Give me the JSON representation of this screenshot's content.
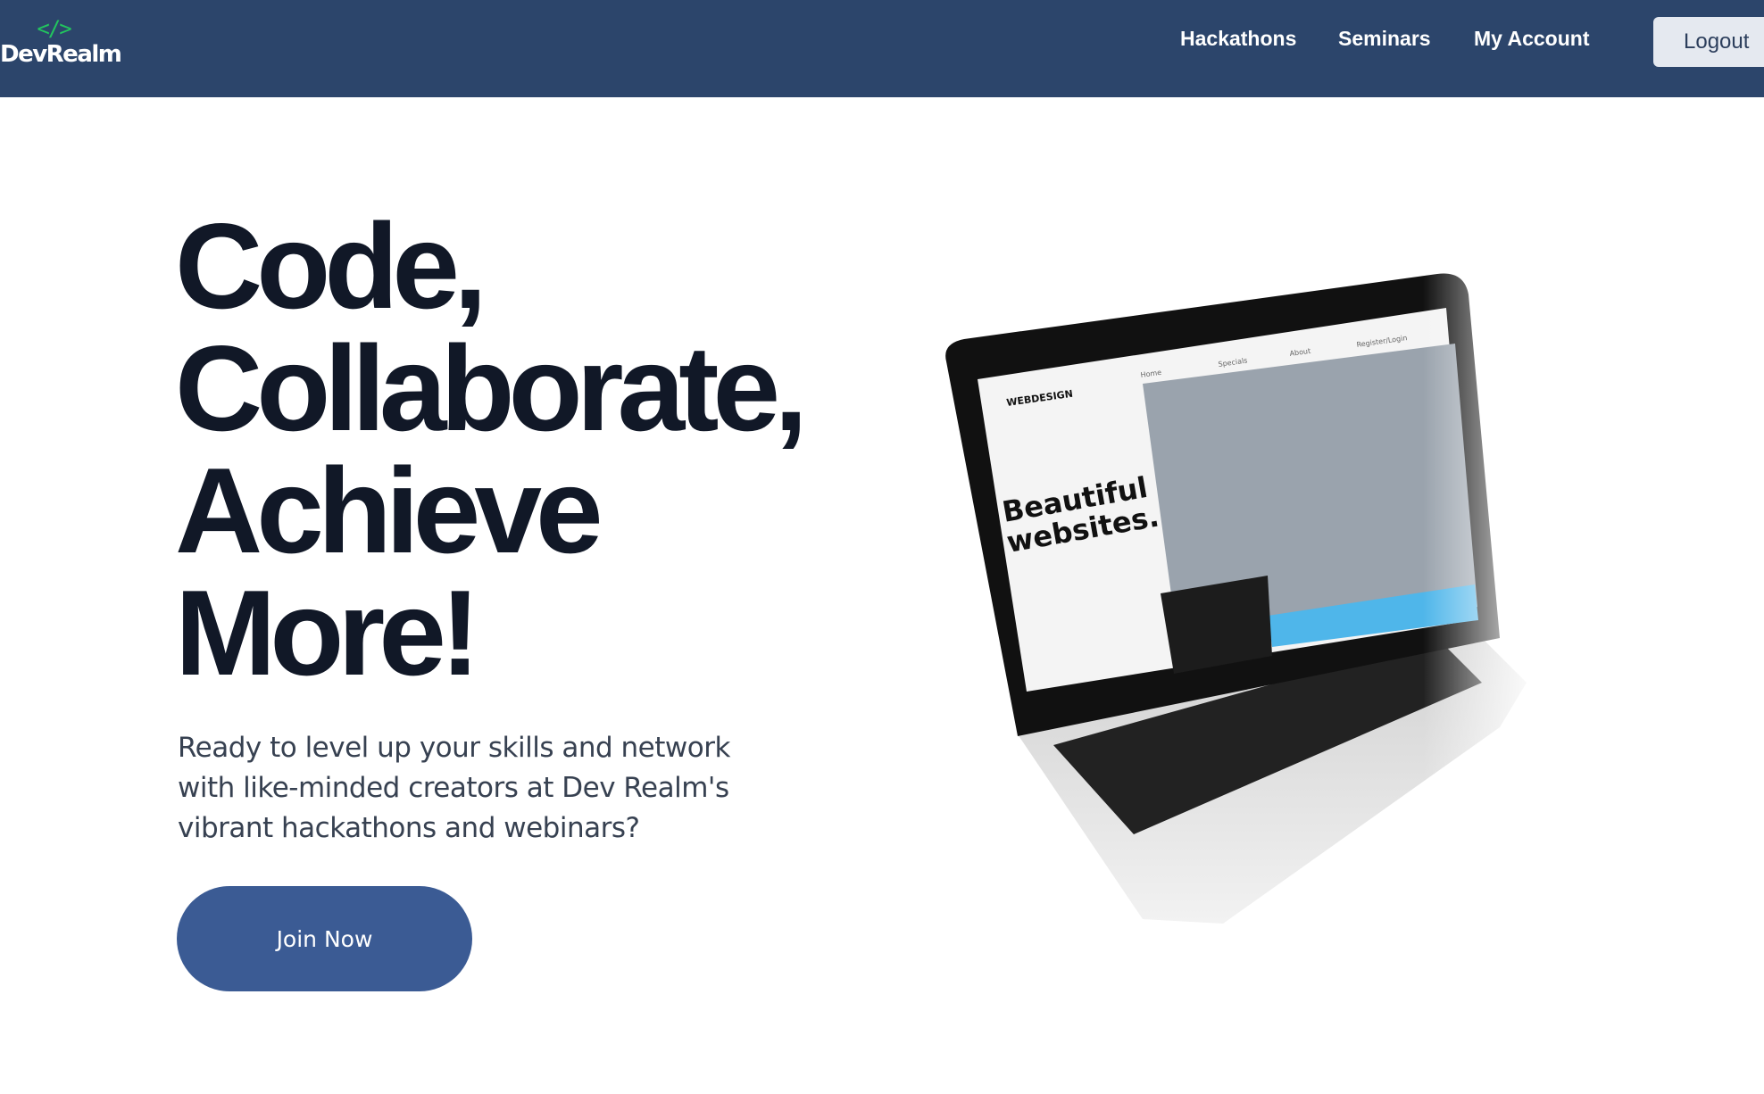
{
  "nav": {
    "logo_icon": "</>",
    "logo_text": "DevRealm",
    "links": [
      "Hackathons",
      "Seminars",
      "My Account"
    ],
    "logout_label": "Logout"
  },
  "hero": {
    "headline": [
      "Code,",
      "Collaborate,",
      "Achieve",
      "More!"
    ],
    "lead": "Ready to level up your skills and network with like-minded creators at Dev Realm's vibrant hackathons and webinars?",
    "cta_label": "Join Now",
    "image": {
      "brand": "WEBDESIGN",
      "title_lines": [
        "Beautiful",
        "websites."
      ],
      "menu": [
        "Home",
        "Specials",
        "About",
        "Register/Login"
      ]
    }
  },
  "colors": {
    "nav_bg": "#2c456b",
    "accent_green": "#22c55e",
    "button": "#3b5b94",
    "headline": "#111827"
  }
}
